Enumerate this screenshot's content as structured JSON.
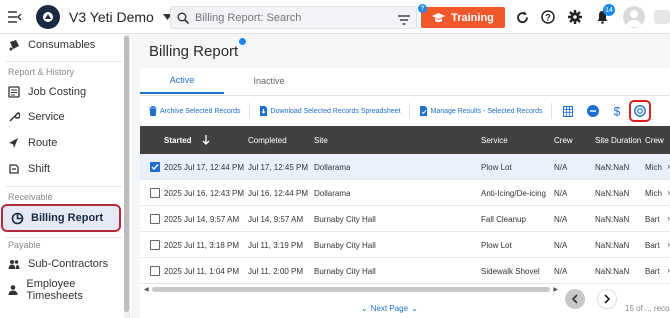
{
  "topbar": {
    "app_title": "V3 Yeti Demo",
    "search_placeholder": "Billing Report: Search",
    "training_label": "Training",
    "training_badge": "?",
    "notification_count": "14"
  },
  "sidebar": {
    "items_top": [
      {
        "label": "Consumables",
        "icon": "consumables-icon"
      }
    ],
    "section_report": "Report & History",
    "report_items": [
      {
        "label": "Job Costing",
        "icon": "job-costing-icon"
      },
      {
        "label": "Service",
        "icon": "service-icon"
      },
      {
        "label": "Route",
        "icon": "route-icon"
      },
      {
        "label": "Shift",
        "icon": "shift-icon"
      }
    ],
    "section_receivable": "Receivable",
    "receivable_items": [
      {
        "label": "Billing Report",
        "icon": "billing-report-icon",
        "active": true
      }
    ],
    "section_payable": "Payable",
    "payable_items": [
      {
        "label": "Sub-Contractors",
        "icon": "sub-contractors-icon"
      },
      {
        "label": "Employee Timesheets",
        "icon": "employee-timesheets-icon"
      }
    ]
  },
  "main": {
    "page_title": "Billing Report",
    "tabs": [
      {
        "label": "Active",
        "active": true
      },
      {
        "label": "Inactive",
        "active": false
      }
    ],
    "actions": [
      {
        "label": "Archive Selected Records",
        "icon": "trash-icon"
      },
      {
        "label": "Download Selected Records Spreadsheet",
        "icon": "download-icon"
      },
      {
        "label": "Manage Results - Selected Records",
        "icon": "manage-results-icon"
      }
    ],
    "columns": [
      "Started",
      "Completed",
      "Site",
      "Service",
      "Crew",
      "Site Duration",
      "Crew"
    ],
    "rows": [
      {
        "selected": true,
        "started": "2025 Jul 17, 12:44 PM",
        "completed": "Jul 17, 12:45 PM",
        "site": "Dollarama",
        "service": "Plow Lot",
        "crew": "N/A",
        "duration": "NaN:NaN",
        "crew2": "Mich"
      },
      {
        "selected": false,
        "started": "2025 Jul 16, 12:43 PM",
        "completed": "Jul 16, 12:44 PM",
        "site": "Dollarama",
        "service": "Anti-Icing/De-icing",
        "crew": "N/A",
        "duration": "NaN:NaN",
        "crew2": "Mich"
      },
      {
        "selected": false,
        "started": "2025 Jul 14, 9:57 AM",
        "completed": "Jul 14, 9:57 AM",
        "site": "Burnaby City Hall",
        "service": "Fall Cleanup",
        "crew": "N/A",
        "duration": "NaN:NaN",
        "crew2": "Bart"
      },
      {
        "selected": false,
        "started": "2025 Jul 11, 3:18 PM",
        "completed": "Jul 11, 3:19 PM",
        "site": "Burnaby City Hall",
        "service": "Plow Lot",
        "crew": "N/A",
        "duration": "NaN:NaN",
        "crew2": "Bart"
      },
      {
        "selected": false,
        "started": "2025 Jul 11, 1:04 PM",
        "completed": "Jul 11, 2:00 PM",
        "site": "Burnaby City Hall",
        "service": "Sidewalk Shovel",
        "crew": "N/A",
        "duration": "NaN:NaN",
        "crew2": "Bart"
      }
    ],
    "next_page_label": "Next Page",
    "count_text": "15 of ... reco"
  },
  "colors": {
    "accent": "#1e6fd0",
    "training": "#f0582b",
    "header_bg": "#414141",
    "highlight": "#d92020"
  }
}
